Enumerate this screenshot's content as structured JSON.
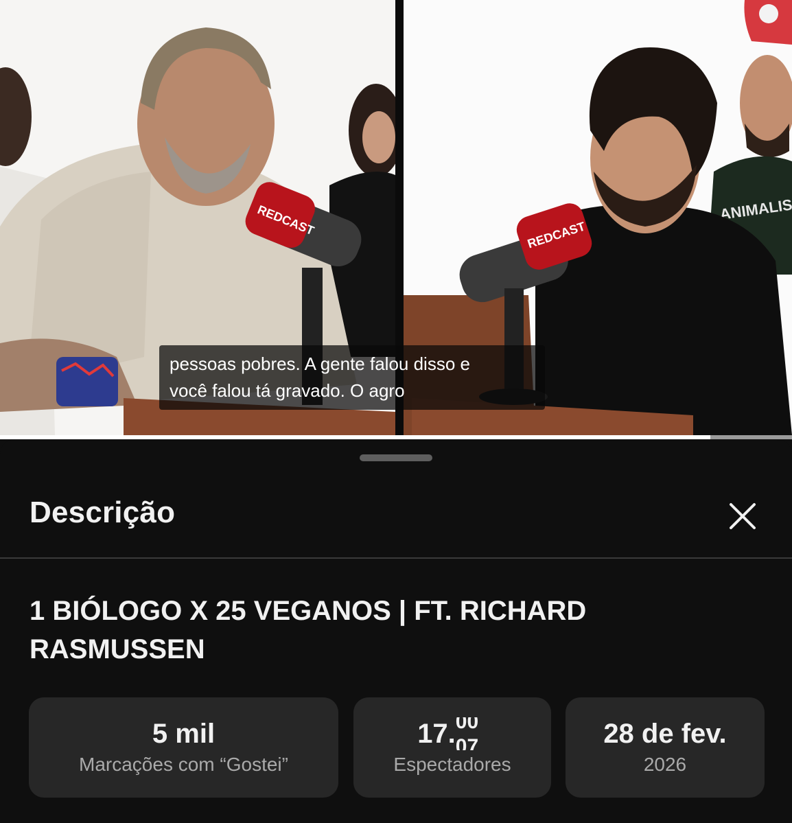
{
  "video": {
    "caption_line1": "pessoas pobres. A gente falou disso e",
    "caption_line2": "você falou tá gravado. O agro",
    "mic_brand": "REDCAST",
    "shirt_text": "ANIMALIS",
    "progress_fraction": 0.897
  },
  "sheet": {
    "title": "Descrição",
    "close_icon": "close-icon"
  },
  "video_title": "1 BIÓLOGO X 25 VEGANOS | FT. RICHARD RASMUSSEN",
  "stats": {
    "likes": {
      "value": "5 mil",
      "label": "Marcações com “Gostei”"
    },
    "views": {
      "value_prefix": "17.",
      "rolling_top": "00",
      "rolling_bottom": "07",
      "label": "Espectadores"
    },
    "date": {
      "value": "28 de fev.",
      "label": "2026"
    }
  },
  "colors": {
    "background": "#0f0f0f",
    "card": "#272727",
    "text": "#f1f1f1",
    "secondary_text": "#aaaaaa",
    "brand_red": "#d2232a"
  }
}
